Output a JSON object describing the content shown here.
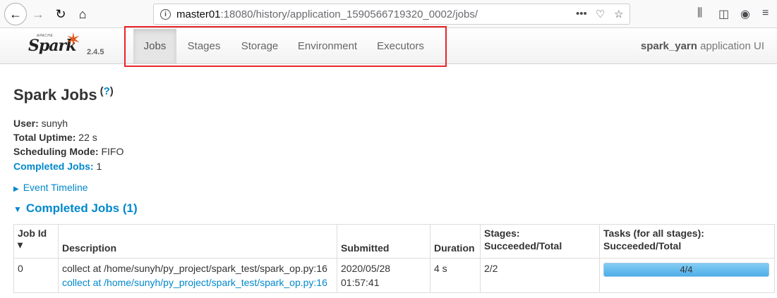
{
  "browser": {
    "url_host": "master01",
    "url_rest": ":18080/history/application_1590566719320_0002/jobs/"
  },
  "navbar": {
    "logo_word": "Spark",
    "logo_apache": "APACHE",
    "version": "2.4.5",
    "tabs": [
      {
        "label": "Jobs",
        "active": true
      },
      {
        "label": "Stages",
        "active": false
      },
      {
        "label": "Storage",
        "active": false
      },
      {
        "label": "Environment",
        "active": false
      },
      {
        "label": "Executors",
        "active": false
      }
    ],
    "app_name": "spark_yarn",
    "app_suffix": " application UI"
  },
  "page": {
    "title": "Spark Jobs",
    "help": "?",
    "user_label": "User:",
    "user": " sunyh",
    "uptime_label": "Total Uptime:",
    "uptime": " 22 s",
    "mode_label": "Scheduling Mode:",
    "mode": " FIFO",
    "completed_label": "Completed Jobs:",
    "completed": " 1",
    "timeline": "Event Timeline",
    "section_title": "Completed Jobs (1)"
  },
  "table": {
    "headers": {
      "job_id": "Job Id",
      "sort": "▾",
      "description": "Description",
      "submitted": "Submitted",
      "duration": "Duration",
      "stages_1": "Stages:",
      "stages_2": "Succeeded/Total",
      "tasks_1": "Tasks (for all stages):",
      "tasks_2": "Succeeded/Total"
    },
    "rows": [
      {
        "job_id": "0",
        "description": "collect at /home/sunyh/py_project/spark_test/spark_op.py:16",
        "description_link": "collect at /home/sunyh/py_project/spark_test/spark_op.py:16",
        "submitted_date": "2020/05/28",
        "submitted_time": "01:57:41",
        "duration": "4 s",
        "stages": "2/2",
        "tasks": "4/4",
        "tasks_progress": 1.0
      }
    ]
  }
}
